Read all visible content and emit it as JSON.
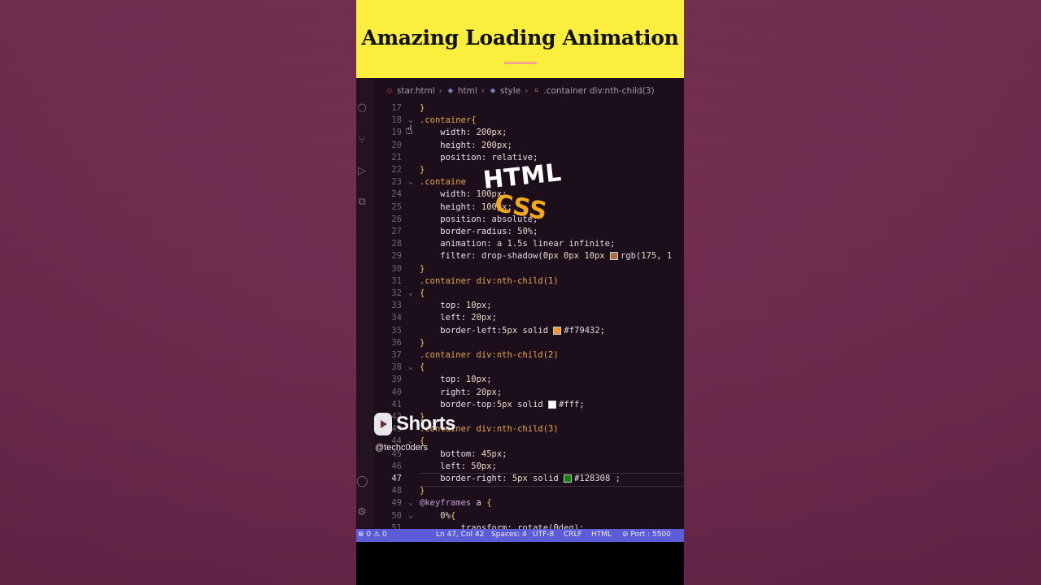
{
  "banner": {
    "title": "Amazing Loading Animation"
  },
  "breadcrumb": {
    "items": [
      {
        "icon": "html-file-icon",
        "label": "star.html"
      },
      {
        "icon": "cube-icon",
        "label": "html"
      },
      {
        "icon": "cube-icon",
        "label": "style"
      },
      {
        "icon": "selector-icon",
        "label": ".container div:nth-child(3)"
      }
    ]
  },
  "code_lines": [
    {
      "n": "17",
      "fold": "",
      "html": "<span class=\"c-brace\">}</span>"
    },
    {
      "n": "18",
      "fold": "v",
      "html": "<span class=\"c-sel\">.container</span><span class=\"c-brace\">{</span>"
    },
    {
      "n": "19",
      "fold": "",
      "html": "    <span class=\"c-prop\">width</span>: <span class=\"c-num\">200px</span>;"
    },
    {
      "n": "20",
      "fold": "",
      "html": "    <span class=\"c-prop\">height</span>: <span class=\"c-num\">200px</span>;"
    },
    {
      "n": "21",
      "fold": "",
      "html": "    <span class=\"c-prop\">position</span>: relative;"
    },
    {
      "n": "22",
      "fold": "",
      "html": "<span class=\"c-brace\">}</span>"
    },
    {
      "n": "23",
      "fold": "v",
      "html": "<span class=\"c-sel\">.containe</span>"
    },
    {
      "n": "24",
      "fold": "",
      "html": "    <span class=\"c-prop\">width</span>: <span class=\"c-num\">100px</span>;"
    },
    {
      "n": "25",
      "fold": "",
      "html": "    <span class=\"c-prop\">height</span>: <span class=\"c-num\">100px</span>;"
    },
    {
      "n": "26",
      "fold": "",
      "html": "    <span class=\"c-prop\">position</span>: absolute;"
    },
    {
      "n": "27",
      "fold": "",
      "html": "    <span class=\"c-prop\">border-radius</span>: <span class=\"c-num\">50%</span>;"
    },
    {
      "n": "28",
      "fold": "",
      "html": "    <span class=\"c-prop\">animation</span>: a <span class=\"c-num\">1.5s</span> linear infinite;"
    },
    {
      "n": "29",
      "fold": "",
      "html": "    <span class=\"c-prop\">filter</span>: drop-shadow(<span class=\"c-num\">0px 0px 10px</span> <span class=\"sw\" style=\"background:#af6e3c\"></span>rgb(<span class=\"c-num\">175, 1</span>"
    },
    {
      "n": "30",
      "fold": "",
      "html": "<span class=\"c-brace\">}</span>"
    },
    {
      "n": "31",
      "fold": "",
      "html": "<span class=\"c-sel\">.container div:nth-child(1)</span>"
    },
    {
      "n": "32",
      "fold": "v",
      "html": "<span class=\"c-brace\">{</span>"
    },
    {
      "n": "33",
      "fold": "",
      "html": "    <span class=\"c-prop\">top</span>: <span class=\"c-num\">10px</span>;"
    },
    {
      "n": "34",
      "fold": "",
      "html": "    <span class=\"c-prop\">left</span>: <span class=\"c-num\">20px</span>;"
    },
    {
      "n": "35",
      "fold": "",
      "html": "    <span class=\"c-prop\">border-left</span>:<span class=\"c-num\">5px</span> solid <span class=\"sw\" style=\"background:#f79432\"></span>#f79432;"
    },
    {
      "n": "36",
      "fold": "",
      "html": "<span class=\"c-brace\">}</span>"
    },
    {
      "n": "37",
      "fold": "",
      "html": "<span class=\"c-sel\">.container div:nth-child(2)</span>"
    },
    {
      "n": "38",
      "fold": "v",
      "html": "<span class=\"c-brace\">{</span>"
    },
    {
      "n": "39",
      "fold": "",
      "html": "    <span class=\"c-prop\">top</span>: <span class=\"c-num\">10px</span>;"
    },
    {
      "n": "40",
      "fold": "",
      "html": "    <span class=\"c-prop\">right</span>: <span class=\"c-num\">20px</span>;"
    },
    {
      "n": "41",
      "fold": "",
      "html": "    <span class=\"c-prop\">border-top</span>:<span class=\"c-num\">5px</span> solid <span class=\"sw\" style=\"background:#ffffff\"></span>#fff;"
    },
    {
      "n": "42",
      "fold": "",
      "html": "<span class=\"c-brace\">}</span>"
    },
    {
      "n": "43",
      "fold": "",
      "html": "<span class=\"c-sel\">.container div:nth-child(3)</span>"
    },
    {
      "n": "44",
      "fold": "v",
      "html": "<span class=\"c-brace\">{</span>"
    },
    {
      "n": "45",
      "fold": "",
      "html": "    <span class=\"c-prop\">bottom</span>: <span class=\"c-num\">45px</span>;"
    },
    {
      "n": "46",
      "fold": "",
      "html": "    <span class=\"c-prop\">left</span>: <span class=\"c-num\">50px</span>;"
    },
    {
      "n": "47",
      "fold": "",
      "html": "    <span class=\"c-prop\">border-right</span>: <span class=\"c-num\">5px</span> solid <span class=\"sw\" style=\"background:#128308\"></span>#128308 ;"
    },
    {
      "n": "48",
      "fold": "",
      "html": "<span class=\"c-brace\">}</span>"
    },
    {
      "n": "49",
      "fold": "v",
      "html": "<span class=\"c-kw\">@keyframes</span> a <span class=\"c-brace\">{</span>"
    },
    {
      "n": "50",
      "fold": "v",
      "html": "    <span class=\"c-num\">0%</span><span class=\"c-brace\">{</span>"
    },
    {
      "n": "51",
      "fold": "",
      "html": "        transform: rotate(0deg);"
    }
  ],
  "active_line": "47",
  "overlay": {
    "html_label": "HTML",
    "css_label": "CSS"
  },
  "status_bar": {
    "problems": "0",
    "warnings": "0",
    "position": "Ln 47, Col 42",
    "spaces": "Spaces: 4",
    "encoding": "UTF-8",
    "eol": "CRLF",
    "language": "HTML",
    "port": "Port : 5500"
  },
  "shorts": {
    "label": "Shorts",
    "handle": "@techc0ders"
  },
  "colors": {
    "banner": "#fbee3f",
    "status_bar": "#5c5cd8",
    "editor_bg": "#1c0f1b"
  }
}
